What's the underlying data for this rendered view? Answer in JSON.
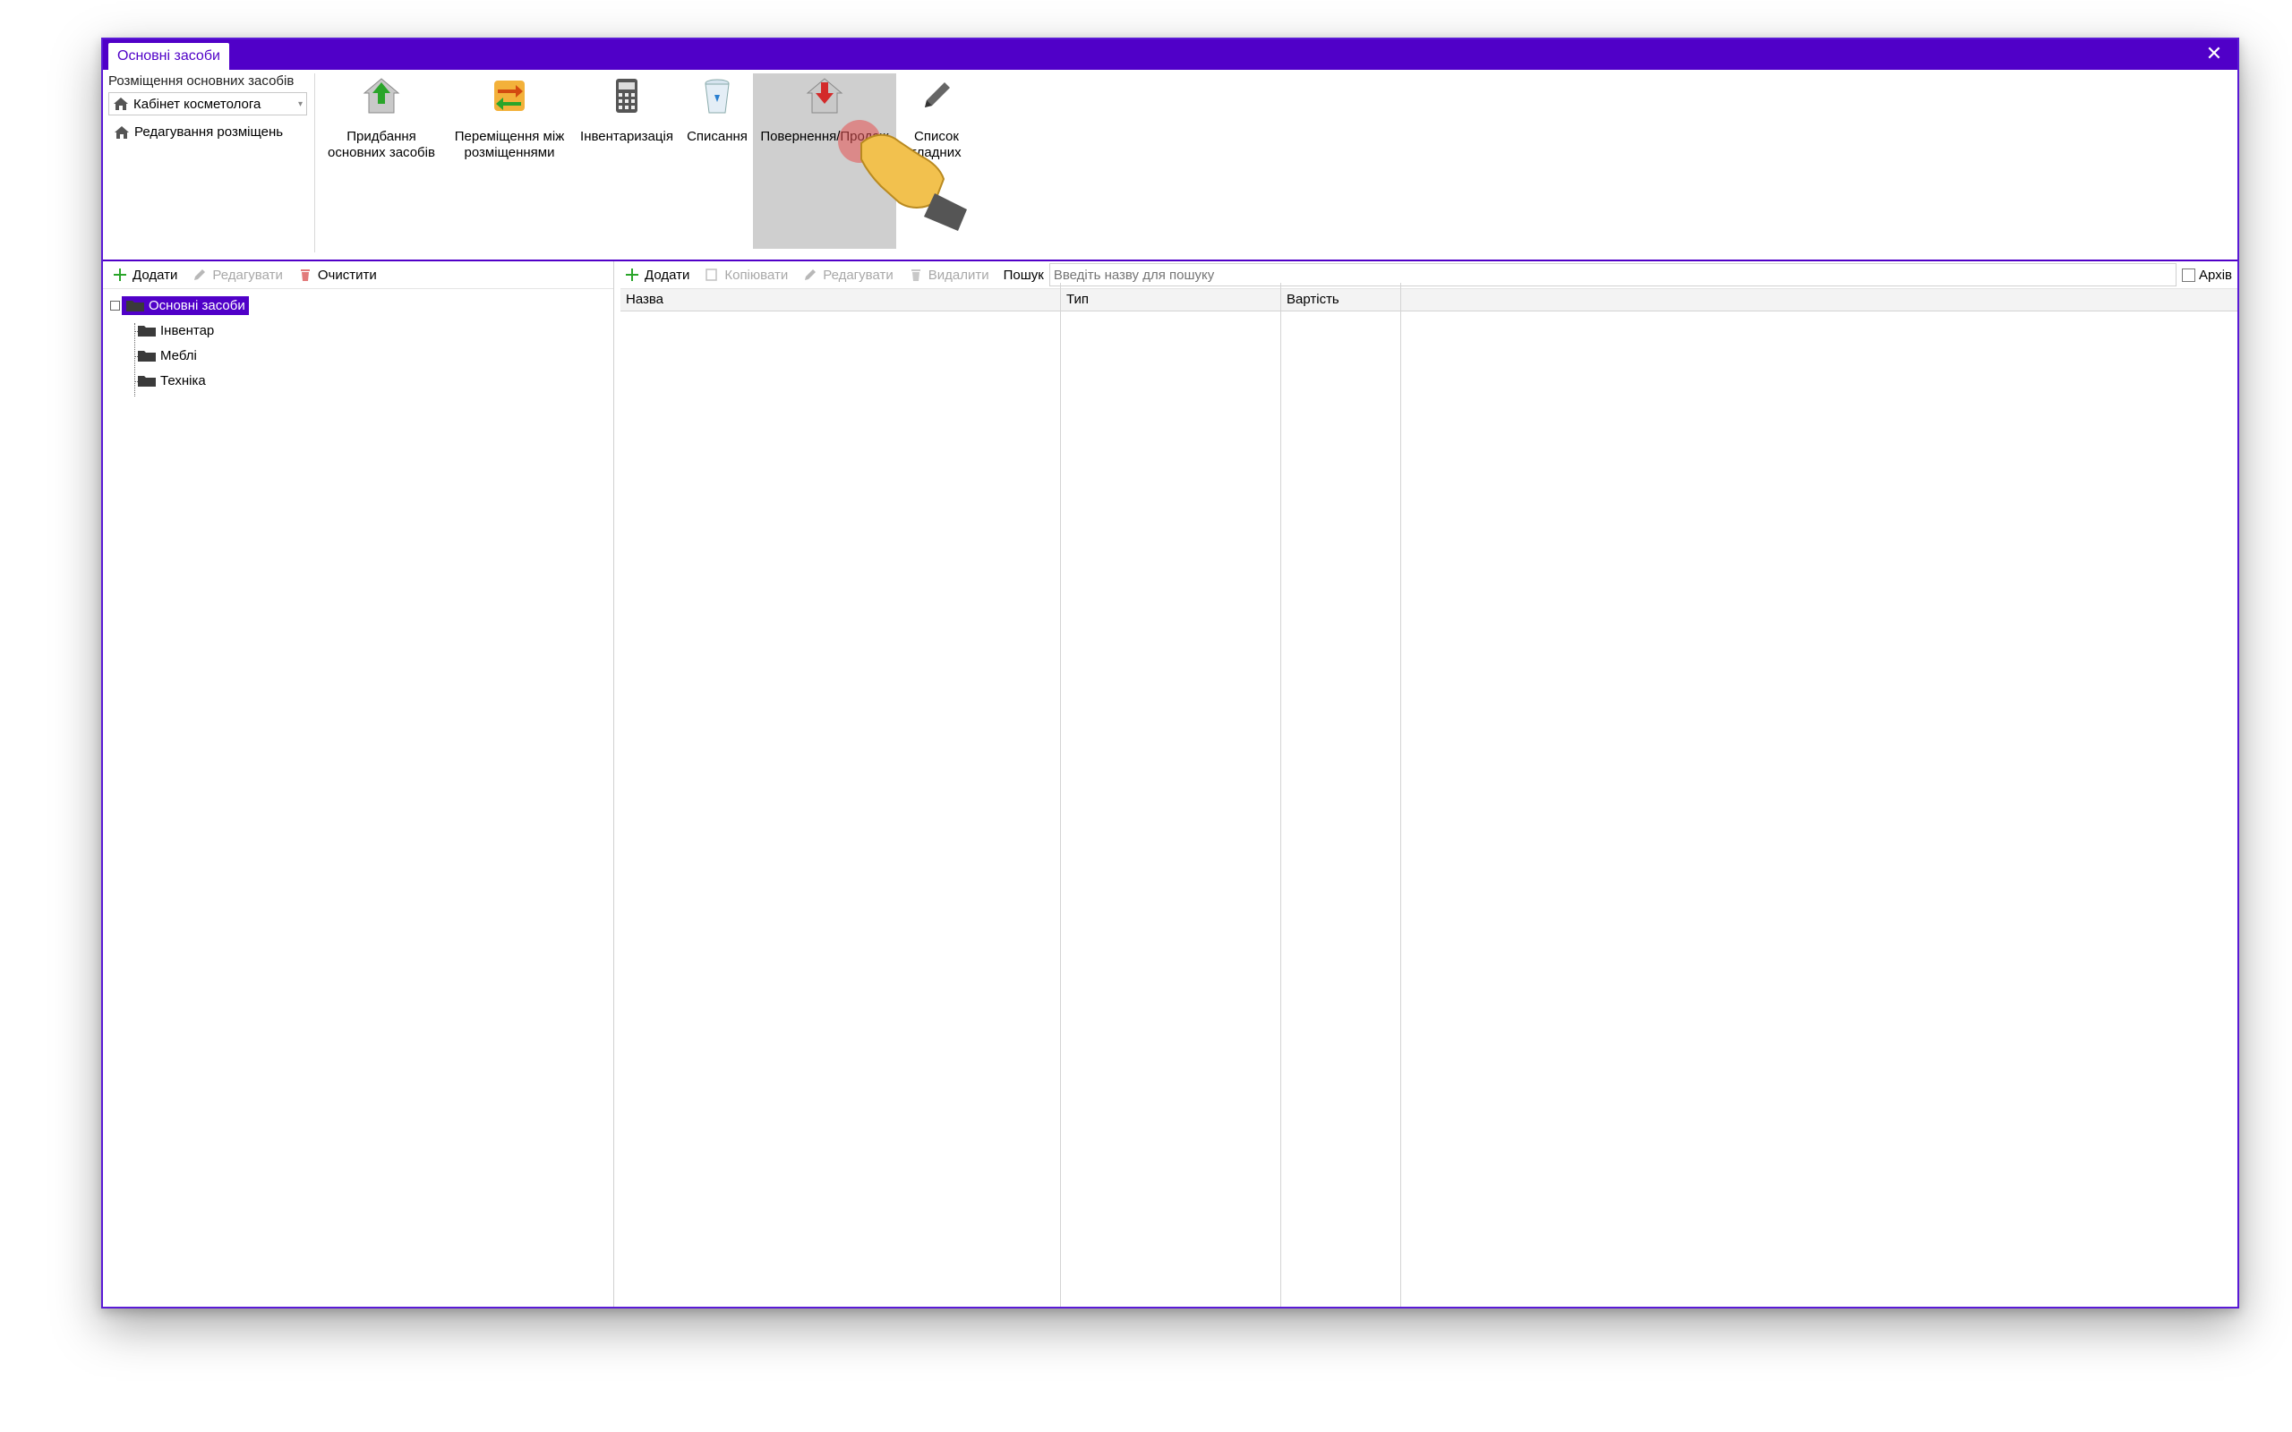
{
  "window": {
    "tab_title": "Основні засоби",
    "close_glyph": "✕",
    "accent_color": "#5000c8"
  },
  "ribbon": {
    "placement_group_title": "Розміщення основних засобів",
    "placement_selected": "Кабінет косметолога",
    "edit_placements": "Редагування розміщень",
    "buttons": [
      {
        "label": "Придбання основних засобів",
        "icon": "house-green-arrow-icon"
      },
      {
        "label": "Переміщення між розміщеннями",
        "icon": "swap-arrows-icon"
      },
      {
        "label": "Інвентаризація",
        "icon": "calculator-icon"
      },
      {
        "label": "Списання",
        "icon": "trash-bin-icon"
      },
      {
        "label": "Повернення/Продаж",
        "icon": "house-red-arrow-icon"
      },
      {
        "label": "Список гладних",
        "icon": "pencil-icon"
      }
    ]
  },
  "left_toolbar": {
    "add": "Додати",
    "edit": "Редагувати",
    "clear": "Очистити"
  },
  "tree": {
    "root": "Основні засоби",
    "children": [
      "Інвентар",
      "Меблі",
      "Техніка"
    ]
  },
  "right_toolbar": {
    "add": "Додати",
    "copy": "Копіювати",
    "edit": "Редагувати",
    "delete": "Видалити",
    "search_label": "Пошук",
    "search_placeholder": "Введіть назву для пошуку",
    "archive": "Архів"
  },
  "grid": {
    "columns": [
      "Назва",
      "Тип",
      "Вартість"
    ]
  }
}
